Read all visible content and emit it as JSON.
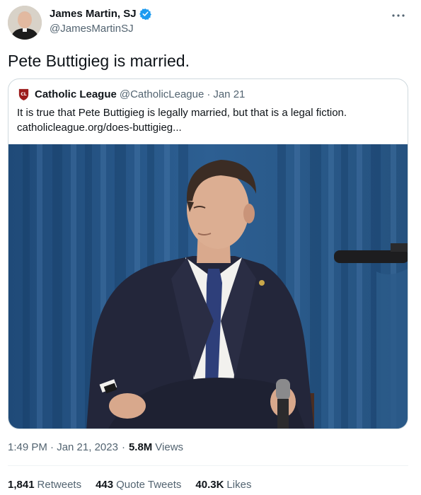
{
  "tweet": {
    "author": {
      "name": "James Martin, SJ",
      "handle": "@JamesMartinSJ",
      "verified": true
    },
    "text": "Pete Buttigieg is married.",
    "timestamp": "1:49 PM · Jan 21, 2023",
    "views_count": "5.8M",
    "views_label": "Views",
    "stats": {
      "retweets_count": "1,841",
      "retweets_label": "Retweets",
      "quotes_count": "443",
      "quotes_label": "Quote Tweets",
      "likes_count": "40.3K",
      "likes_label": "Likes"
    }
  },
  "quoted_tweet": {
    "name": "Catholic League",
    "handle": "@CatholicLeague",
    "separator": "·",
    "date": "Jan 21",
    "text_line1": "It is true that Pete Buttigieg is legally married, but that is a legal fiction.",
    "text_line2": "catholicleague.org/does-buttigieg...",
    "logo_text": "CL"
  },
  "colors": {
    "verified_blue": "#1d9bf0",
    "link_gray": "#536471",
    "curtain_blue": "#2b5a8a",
    "logo_red": "#9c1c1c"
  },
  "icons": {
    "verified": "verified-badge-icon",
    "more": "more-horizontal-icon"
  }
}
